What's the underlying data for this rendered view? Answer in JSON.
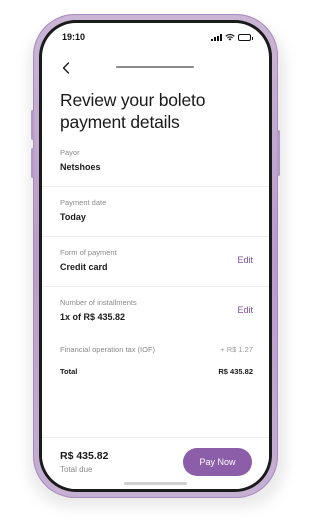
{
  "status_bar": {
    "time": "19:10"
  },
  "header": {
    "title": "Review your boleto payment details"
  },
  "details": {
    "payor": {
      "label": "Payor",
      "value": "Netshoes"
    },
    "payment_date": {
      "label": "Payment date",
      "value": "Today"
    },
    "form_of_payment": {
      "label": "Form of payment",
      "value": "Credit card",
      "action": "Edit"
    },
    "installments": {
      "label": "Number of installments",
      "value": "1x of R$ 435.82",
      "action": "Edit"
    },
    "tax": {
      "label": "Financial operation tax (IOF)",
      "value": "+ R$ 1.27"
    },
    "total": {
      "label": "Total",
      "value": "R$ 435.82"
    }
  },
  "footer": {
    "amount": "R$ 435.82",
    "label": "Total due",
    "pay_label": "Pay  Now"
  },
  "colors": {
    "accent": "#8c5ea9",
    "edit_link": "#7b4fa0",
    "frame": "#b89cc9"
  },
  "icons": {
    "back": "chevron-left-icon",
    "signal": "signal-icon",
    "wifi": "wifi-icon",
    "battery": "battery-icon"
  }
}
